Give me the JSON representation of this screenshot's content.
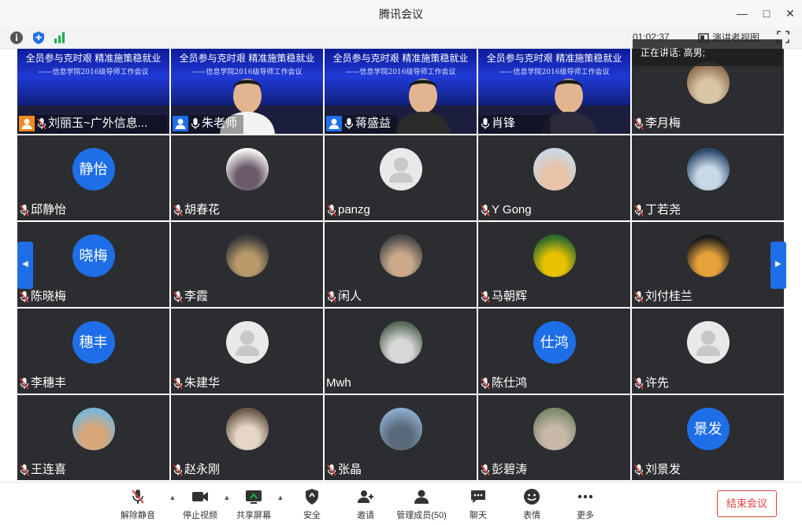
{
  "window": {
    "title": "腾讯会议"
  },
  "infobar": {
    "timer": "01:02:37",
    "view_mode": "演讲者视图"
  },
  "speaking": {
    "label": "正在讲话: 高男;"
  },
  "banner": {
    "line1": "全员参与克时艰 精准施策稳就业",
    "line2": "——信息学院2016级导师工作会议"
  },
  "participants": [
    {
      "name": "刘丽玉~广外信息...",
      "type": "video",
      "host": true
    },
    {
      "name": "朱老师",
      "type": "video",
      "host": true
    },
    {
      "name": "蒋盛益",
      "type": "video",
      "host": true
    },
    {
      "name": "肖锋",
      "type": "video",
      "host": false
    },
    {
      "name": "李月梅",
      "type": "photo"
    },
    {
      "name": "邱静怡",
      "type": "text",
      "avatar_text": "静怡"
    },
    {
      "name": "胡春花",
      "type": "photo"
    },
    {
      "name": "panzg",
      "type": "grey"
    },
    {
      "name": "Y Gong",
      "type": "photo"
    },
    {
      "name": "丁若尧",
      "type": "photo"
    },
    {
      "name": "陈晓梅",
      "type": "text",
      "avatar_text": "晓梅"
    },
    {
      "name": "李霞",
      "type": "photo"
    },
    {
      "name": "闲人",
      "type": "photo"
    },
    {
      "name": "马朝辉",
      "type": "photo"
    },
    {
      "name": "刘付桂兰",
      "type": "photo"
    },
    {
      "name": "李穗丰",
      "type": "text",
      "avatar_text": "穗丰"
    },
    {
      "name": "朱建华",
      "type": "grey"
    },
    {
      "name": "Mwh",
      "type": "photo",
      "no_mic": true
    },
    {
      "name": "陈仕鸿",
      "type": "text",
      "avatar_text": "仕鸿"
    },
    {
      "name": "许先",
      "type": "grey"
    },
    {
      "name": "王连喜",
      "type": "photo"
    },
    {
      "name": "赵永刚",
      "type": "photo"
    },
    {
      "name": "张晶",
      "type": "photo"
    },
    {
      "name": "彭碧涛",
      "type": "photo"
    },
    {
      "name": "刘景发",
      "type": "text",
      "avatar_text": "景发"
    }
  ],
  "toolbar": {
    "unmute": "解除静音",
    "stop_video": "停止视频",
    "share_screen": "共享屏幕",
    "security": "安全",
    "invite": "邀请",
    "manage_members": "管理成员(50)",
    "chat": "聊天",
    "emoji": "表情",
    "more": "更多",
    "end_meeting": "结束会议"
  },
  "colors": {
    "accent": "#1e6ee8",
    "end": "#e0403b",
    "tile": "#2c2d30"
  }
}
